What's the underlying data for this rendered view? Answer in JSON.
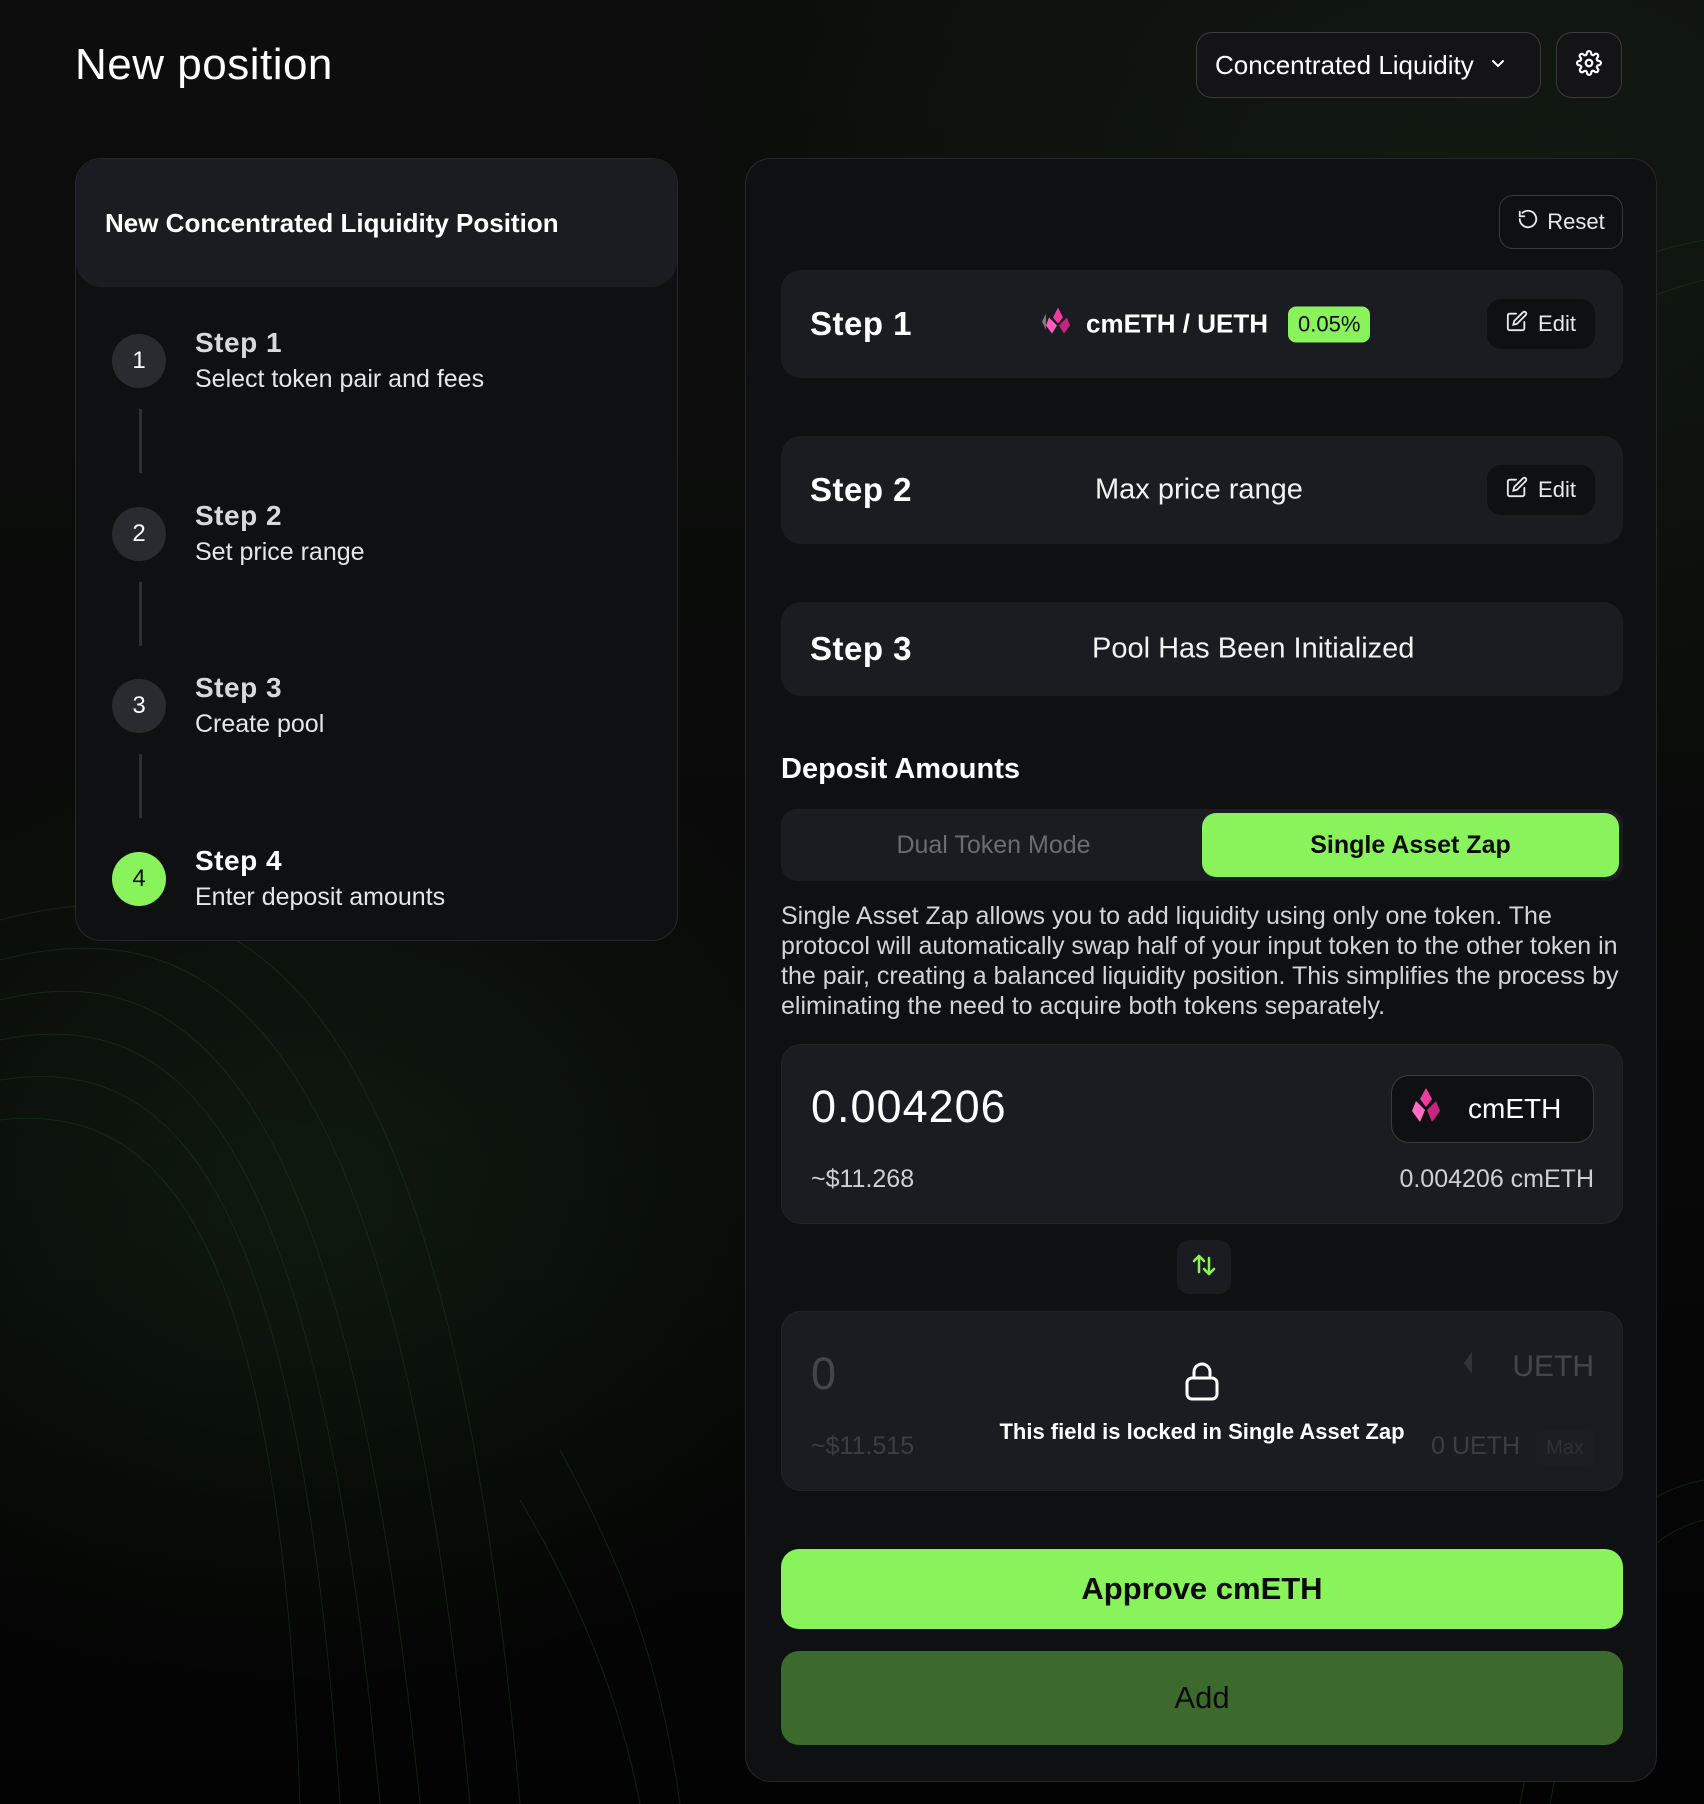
{
  "header": {
    "title": "New position",
    "mode_dropdown": "Concentrated Liquidity"
  },
  "stepper": {
    "title": "New Concentrated Liquidity Position",
    "steps": [
      {
        "num": "1",
        "title": "Step 1",
        "subtitle": "Select token pair and fees"
      },
      {
        "num": "2",
        "title": "Step 2",
        "subtitle": "Set price range"
      },
      {
        "num": "3",
        "title": "Step 3",
        "subtitle": "Create pool"
      },
      {
        "num": "4",
        "title": "Step 4",
        "subtitle": "Enter deposit amounts"
      }
    ]
  },
  "main": {
    "reset_label": "Reset",
    "summary": {
      "step1_label": "Step 1",
      "pair": "cmETH / UETH",
      "fee": "0.05%",
      "step2_label": "Step 2",
      "step2_value": "Max price range",
      "step3_label": "Step 3",
      "step3_value": "Pool Has Been Initialized",
      "edit_label": "Edit"
    },
    "deposit": {
      "title": "Deposit Amounts",
      "mode_dual": "Dual Token Mode",
      "mode_zap": "Single Asset Zap",
      "description": "Single Asset Zap allows you to add liquidity using only one token. The protocol will automatically swap half of your input token to the other token in the pair, creating a balanced liquidity position. This simplifies the process by eliminating the need to acquire both tokens separately.",
      "token_a": {
        "amount": "0.004206",
        "usd": "~$11.268",
        "symbol": "cmETH",
        "balance": "0.004206 cmETH"
      },
      "token_b": {
        "amount": "0",
        "usd": "~$11.515",
        "symbol": "UETH",
        "balance": "0 UETH",
        "max_label": "Max",
        "locked_text": "This field is locked in Single Asset Zap"
      },
      "approve_label": "Approve cmETH",
      "add_label": "Add"
    }
  },
  "colors": {
    "accent": "#88f35b",
    "add_button": "#3c6a2d",
    "card": "#0f1012",
    "row": "#1b1c21"
  },
  "icons": {
    "settings": "gear-icon",
    "dropdown": "chevron-down-icon",
    "reset": "reset-icon",
    "edit": "edit-icon",
    "swap": "swap-arrows-icon",
    "lock": "lock-icon",
    "token": "cmeth-token-icon"
  }
}
